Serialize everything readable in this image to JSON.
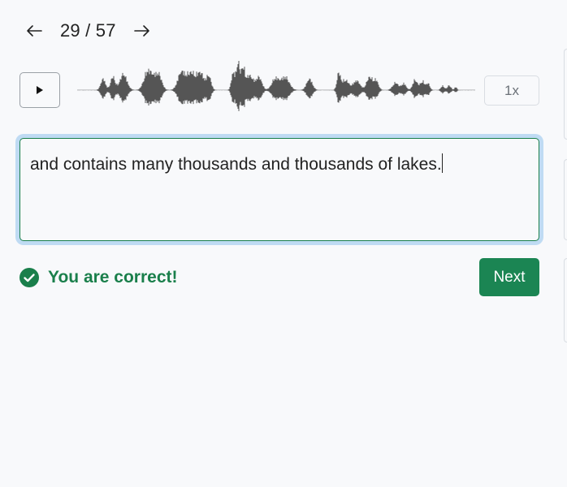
{
  "navigation": {
    "counter": "29 / 57",
    "prev_icon": "arrow-left-icon",
    "next_icon": "arrow-right-icon"
  },
  "player": {
    "play_icon": "play-icon",
    "speed_label": "1x"
  },
  "answer": {
    "value": "and contains many thousands and thousands of lakes."
  },
  "feedback": {
    "icon": "check-circle-icon",
    "message": "You are correct!"
  },
  "actions": {
    "next_label": "Next"
  },
  "colors": {
    "success": "#1a7f4b",
    "next_button": "#1b8553",
    "waveform": "#555555",
    "focus_ring": "#bfdbf3",
    "background": "#f8f9fb"
  }
}
